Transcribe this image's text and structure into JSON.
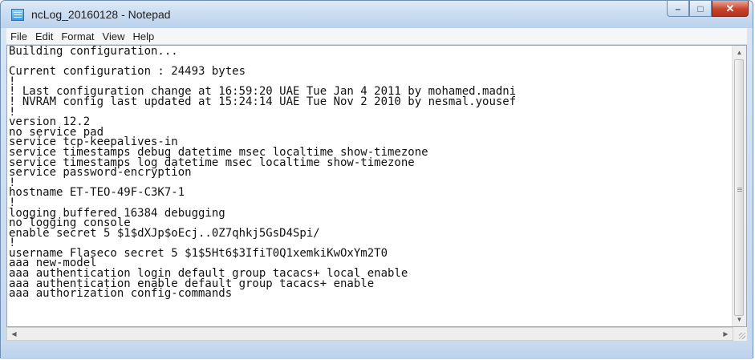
{
  "window": {
    "title": "ncLog_20160128 - Notepad",
    "app_icon": "notepad-icon",
    "controls": {
      "minimize": "–",
      "maximize": "□",
      "close": "✕"
    }
  },
  "menubar": {
    "items": [
      "File",
      "Edit",
      "Format",
      "View",
      "Help"
    ]
  },
  "document": {
    "text": "Building configuration...\n\nCurrent configuration : 24493 bytes\n!\n! Last configuration change at 16:59:20 UAE Tue Jan 4 2011 by mohamed.madni\n! NVRAM config last updated at 15:24:14 UAE Tue Nov 2 2010 by nesmal.yousef\n!\nversion 12.2\nno service pad\nservice tcp-keepalives-in\nservice timestamps debug datetime msec localtime show-timezone\nservice timestamps log datetime msec localtime show-timezone\nservice password-encryption\n!\nhostname ET-TEO-49F-C3K7-1\n!\nlogging buffered 16384 debugging\nno logging console\nenable secret 5 $1$dXJp$oEcj..0Z7qhkj5GsD4Spi/\n!\nusername Flaseco secret 5 $1$5Ht6$3IfiT0Q1xemkiKwOxYm2T0\naaa new-model\naaa authentication login default group tacacs+ local enable\naaa authentication enable default group tacacs+ enable\naaa authorization config-commands"
  },
  "scrollbars": {
    "vertical": {
      "up": "▲",
      "down": "▼"
    },
    "horizontal": {
      "left": "◀",
      "right": "▶"
    }
  },
  "colors": {
    "titlebar": "#c9dcf1",
    "close_button": "#c8432b",
    "editor_background": "#ffffff"
  }
}
